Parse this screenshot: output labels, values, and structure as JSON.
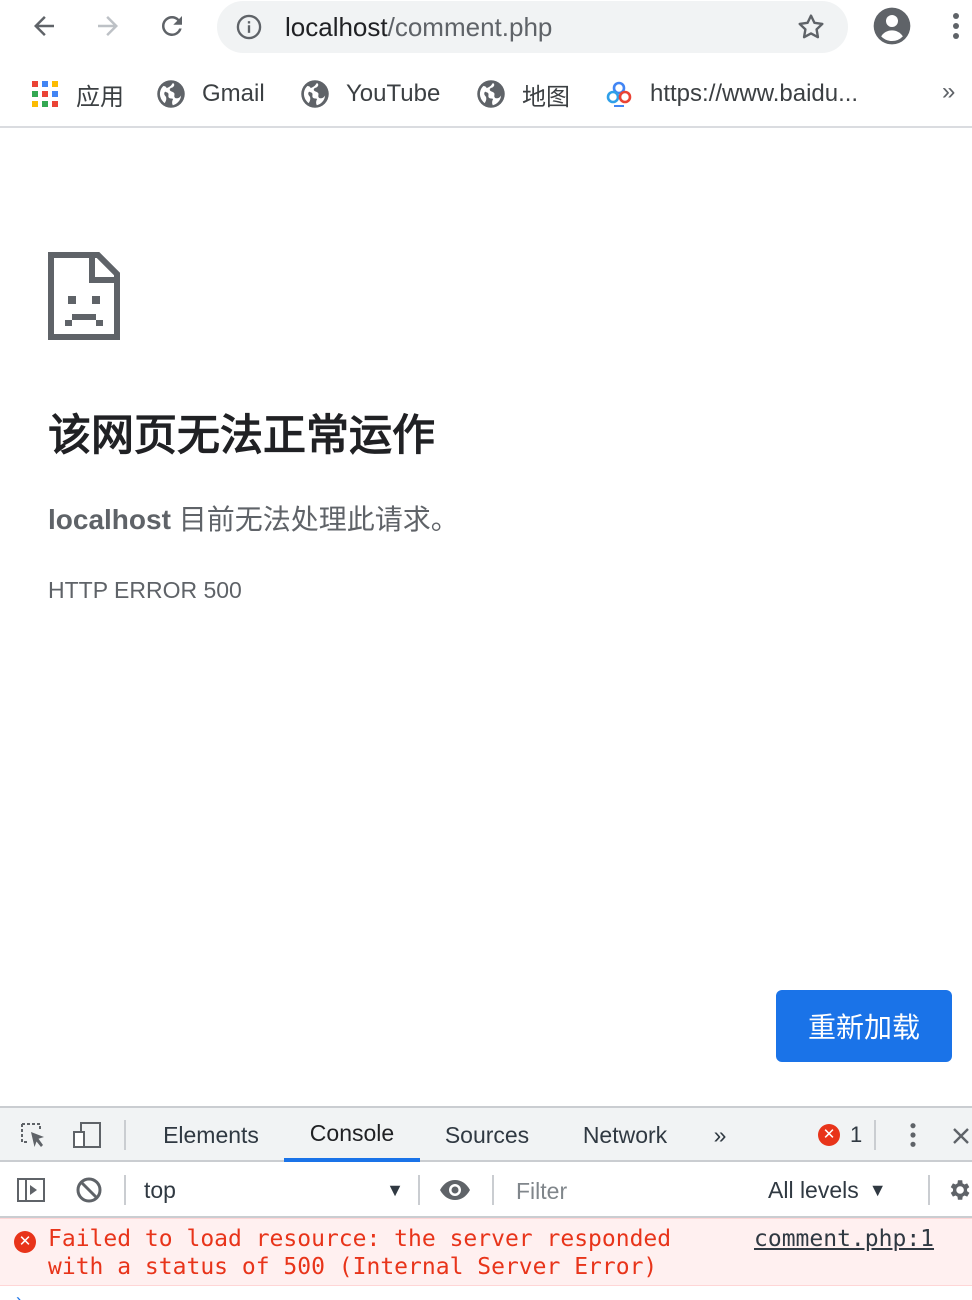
{
  "browser": {
    "url_host": "localhost",
    "url_path": "/comment.php"
  },
  "bookmarks": {
    "items": [
      {
        "label": "应用",
        "icon": "apps-grid-icon"
      },
      {
        "label": "Gmail",
        "icon": "globe-icon"
      },
      {
        "label": "YouTube",
        "icon": "globe-icon"
      },
      {
        "label": "地图",
        "icon": "globe-icon"
      },
      {
        "label": "https://www.baidu...",
        "icon": "baidu-icon"
      }
    ],
    "more": "»"
  },
  "error_page": {
    "title": "该网页无法正常运作",
    "subtitle_host": "localhost",
    "subtitle_rest": " 目前无法处理此请求。",
    "code": "HTTP ERROR 500",
    "reload_label": "重新加载"
  },
  "devtools": {
    "tabs": [
      "Elements",
      "Console",
      "Sources",
      "Network"
    ],
    "active_tab": "Console",
    "more_tabs": "»",
    "error_count": "1",
    "context": "top",
    "filter_placeholder": "Filter",
    "levels_label": "All levels",
    "messages": [
      {
        "text": "Failed to load resource: the server responded\nwith a status of 500 (Internal Server Error)",
        "source": "comment.php:1"
      }
    ]
  },
  "colors": {
    "accent": "#1a73e8",
    "error": "#e8341a",
    "error_bg": "#fff0f0"
  }
}
